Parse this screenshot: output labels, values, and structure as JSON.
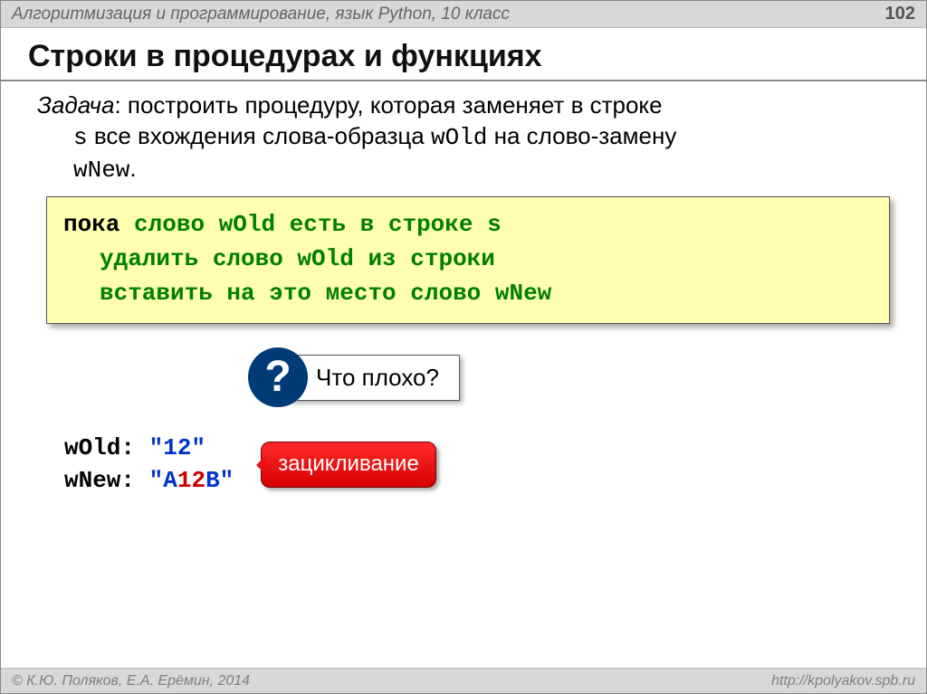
{
  "header": {
    "course": "Алгоритмизация и программирование, язык Python, 10 класс",
    "page": "102"
  },
  "title": "Строки в процедурах и функциях",
  "task": {
    "label": "Задача",
    "line1a": ": построить процедуру, которая заменяет в строке",
    "code_s": "s",
    "line2a": " все вхождения слова-образца ",
    "code_wold": "wOld",
    "line2b": " на слово-замену",
    "code_wnew": "wNew",
    "period": "."
  },
  "code": {
    "l1a": "пока",
    "l1b": " слово wOld есть в строке s",
    "l2": "удалить слово wOld из строки",
    "l3": "вставить на это место слово wNew"
  },
  "question": {
    "mark": "?",
    "text": "Что плохо?"
  },
  "example": {
    "wold_label": "wOld: ",
    "wold_val": "\"12\"",
    "wnew_label": "wNew: ",
    "wnew_q1": "\"",
    "wnew_a": "A",
    "wnew_12": "12",
    "wnew_b": "B",
    "wnew_q2": "\"",
    "warning": "зацикливание"
  },
  "footer": {
    "left": "© К.Ю. Поляков, Е.А. Ерёмин, 2014",
    "right": "http://kpolyakov.spb.ru"
  }
}
